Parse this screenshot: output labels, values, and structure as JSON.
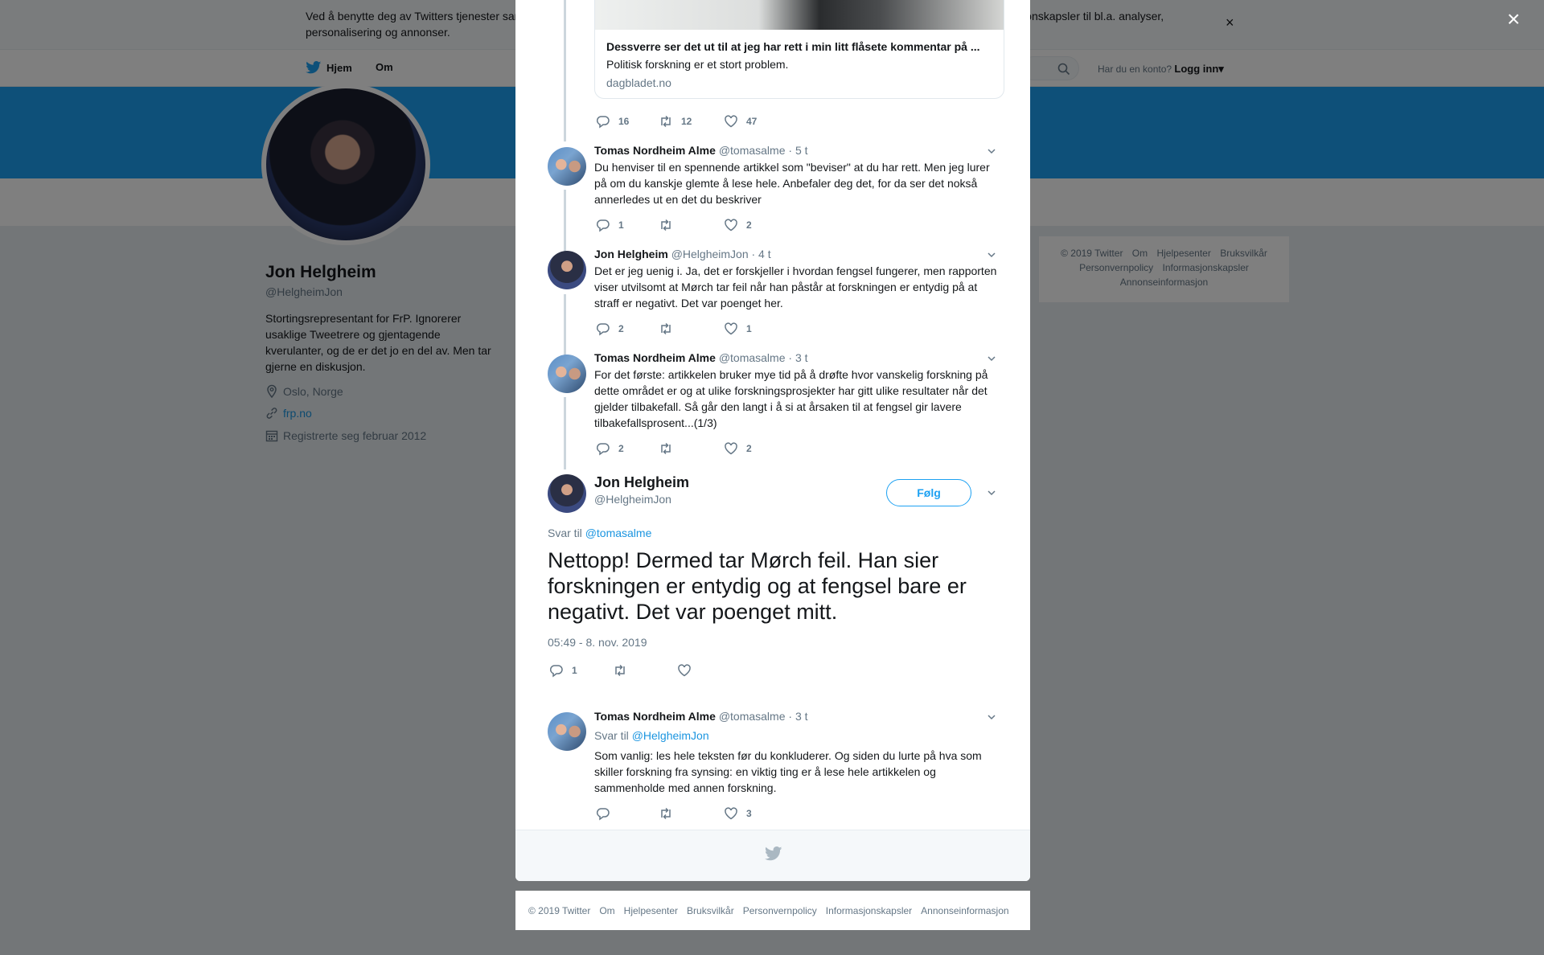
{
  "cookie_bar": {
    "text": "Ved å benytte deg av Twitters tjenester samtykker du til vår bruk av informasjonskapsler. Vi og våre partnere opererer globalt og bruker informasjonskapsler til bl.a. analyser, personalisering og annonser.",
    "close_label": "×"
  },
  "nav": {
    "home": "Hjem",
    "about": "Om",
    "login_prompt": "Har du en konto?",
    "login": "Logg inn"
  },
  "profile": {
    "name": "Jon Helgheim",
    "handle": "@HelgheimJon",
    "bio": "Stortingsrepresentant for FrP. Ignorerer usaklige Tweetrere og gjentagende kverulanter, og de er det jo en del av. Men tar gjerne en diskusjon.",
    "location": "Oslo, Norge",
    "website": "frp.no",
    "joined": "Registrerte seg februar 2012"
  },
  "right_footer": [
    "© 2019 Twitter",
    "Om",
    "Hjelpesenter",
    "Bruksvilkår",
    "Personvernpolicy",
    "Informasjonskapsler",
    "Annonseinformasjon"
  ],
  "modal": {
    "close_label": "×",
    "card": {
      "title": "Dessverre ser det ut til at jeg har rett i min litt flåsete kommentar på ...",
      "description": "Politisk forskning er et stort problem.",
      "domain": "dagbladet.no",
      "replies": "16",
      "retweets": "12",
      "likes": "47"
    },
    "tweets": [
      {
        "name": "Tomas Nordheim Alme",
        "handle": "@tomasalme",
        "time": "· 5 t",
        "text": "Du henviser til en spennende artikkel som \"beviser\" at du har rett. Men jeg lurer på om du kanskje glemte å lese hele. Anbefaler deg det, for da ser det nokså annerledes ut en det du beskriver",
        "replies": "1",
        "retweets": "",
        "likes": "2"
      },
      {
        "name": "Jon Helgheim",
        "handle": "@HelgheimJon",
        "time": "· 4 t",
        "text": "Det er jeg uenig i. Ja, det er forskjeller i hvordan fengsel fungerer, men rapporten viser utvilsomt at Mørch tar feil når han påstår at forskningen er entydig på at straff er negativt. Det var poenget her.",
        "replies": "2",
        "retweets": "",
        "likes": "1"
      },
      {
        "name": "Tomas Nordheim Alme",
        "handle": "@tomasalme",
        "time": "· 3 t",
        "text": "For det første: artikkelen bruker mye tid på å drøfte hvor vanskelig forskning på dette området er og at ulike forskningsprosjekter har gitt ulike resultater når det gjelder tilbakefall.  Så går den langt i å si at årsaken til at fengsel gir lavere tilbakefallsprosent...(1/3)",
        "replies": "2",
        "retweets": "",
        "likes": "2"
      }
    ],
    "main_tweet": {
      "name": "Jon Helgheim",
      "handle": "@HelgheimJon",
      "follow_label": "Følg",
      "reply_prefix": "Svar til",
      "reply_to": "@tomasalme",
      "text": "Nettopp! Dermed tar Mørch feil. Han sier forskningen er entydig og at fengsel bare er negativt. Det var poenget mitt.",
      "timestamp": "05:49 - 8. nov. 2019",
      "replies": "1",
      "retweets": "",
      "likes": ""
    },
    "reply_tweet": {
      "name": "Tomas Nordheim Alme",
      "handle": "@tomasalme",
      "time": "· 3 t",
      "reply_prefix": "Svar til",
      "reply_to": "@HelgheimJon",
      "text": "Som vanlig: les hele teksten før du konkluderer. Og siden du lurte på hva som skiller forskning fra synsing: en viktig ting er å lese hele artikkelen og sammenholde med annen forskning.",
      "replies": "",
      "retweets": "",
      "likes": "3"
    }
  },
  "bottom_footer": [
    "© 2019 Twitter",
    "Om",
    "Hjelpesenter",
    "Bruksvilkår",
    "Personvernpolicy",
    "Informasjonskapsler",
    "Annonseinformasjon"
  ],
  "colors": {
    "brand_blue": "#1da1f2",
    "link_blue": "#1b95e0",
    "secondary_text": "#657786"
  }
}
